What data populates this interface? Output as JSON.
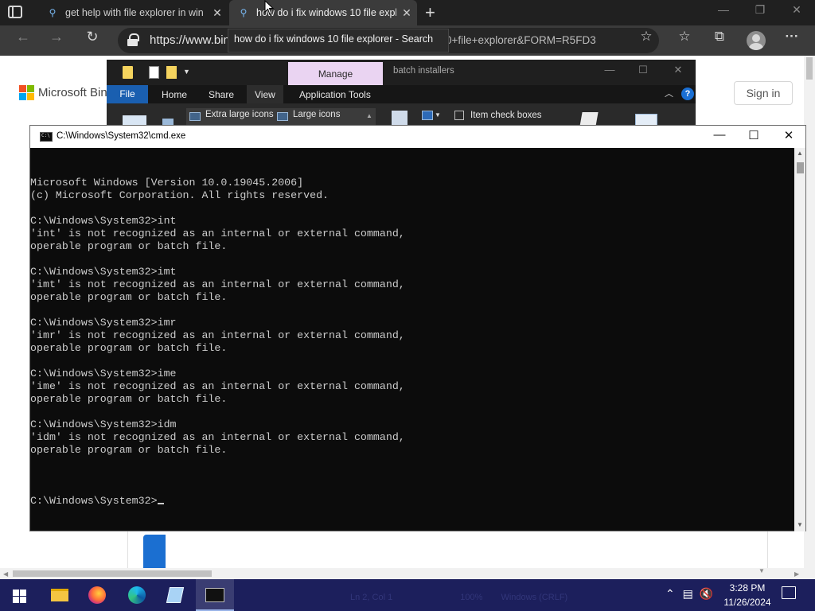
{
  "browser": {
    "tabs": [
      {
        "title": "get help with file explorer in win"
      },
      {
        "title": "how do i fix windows 10 file expl"
      }
    ],
    "tab_close_glyph": "✕",
    "new_tab_glyph": "+",
    "window_buttons": {
      "minimize": "—",
      "restore": "❐",
      "close": "✕"
    },
    "nav": {
      "back": "←",
      "forward": "→",
      "refresh": "↻"
    },
    "url": "https://www.bin",
    "url_tail": "0+file+explorer&FORM=R5FD3",
    "tooltip": "how do i fix windows 10 file explorer - Search",
    "tools": {
      "add_favorite": "☆",
      "favorites": "☆",
      "collections": "⧉",
      "more": "···"
    }
  },
  "bing": {
    "brand": "Microsoft Bin",
    "sign_in": "Sign in",
    "logo_colors": [
      "#f25022",
      "#7fba00",
      "#00a4ef",
      "#ffb900"
    ]
  },
  "explorer": {
    "context_tab": "Manage",
    "title": "batch installers",
    "ribbon_tabs": [
      "File",
      "Home",
      "Share",
      "View",
      "Application Tools"
    ],
    "layout_options": [
      "Extra large icons",
      "Large icons"
    ],
    "item_check_boxes": "Item check boxes",
    "window_buttons": {
      "minimize": "—",
      "maximize": "☐",
      "close": "✕"
    },
    "help": "?",
    "collapse": "︿"
  },
  "cmd": {
    "title": "C:\\Windows\\System32\\cmd.exe",
    "window_buttons": {
      "minimize": "—",
      "maximize": "☐",
      "close": "✕"
    },
    "lines": [
      "Microsoft Windows [Version 10.0.19045.2006]",
      "(c) Microsoft Corporation. All rights reserved.",
      "",
      "C:\\Windows\\System32>int",
      "'int' is not recognized as an internal or external command,",
      "operable program or batch file.",
      "",
      "C:\\Windows\\System32>imt",
      "'imt' is not recognized as an internal or external command,",
      "operable program or batch file.",
      "",
      "C:\\Windows\\System32>imr",
      "'imr' is not recognized as an internal or external command,",
      "operable program or batch file.",
      "",
      "C:\\Windows\\System32>ime",
      "'ime' is not recognized as an internal or external command,",
      "operable program or batch file.",
      "",
      "C:\\Windows\\System32>idm",
      "'idm' is not recognized as an internal or external command,",
      "operable program or batch file.",
      ""
    ],
    "prompt": "C:\\Windows\\System32>",
    "text_color": "#cccccc",
    "background": "#0c0c0c"
  },
  "taskbar": {
    "apps": [
      "file-explorer-icon",
      "firefox-icon",
      "edge-icon",
      "notepad-icon",
      "cmd-icon"
    ],
    "ghost_status": {
      "position": "Ln 2, Col 1",
      "zoom": "100%",
      "encoding": "Windows (CRLF)"
    },
    "time": "3:28 PM",
    "date": "11/26/2024",
    "accent": "#1c1f5c"
  }
}
